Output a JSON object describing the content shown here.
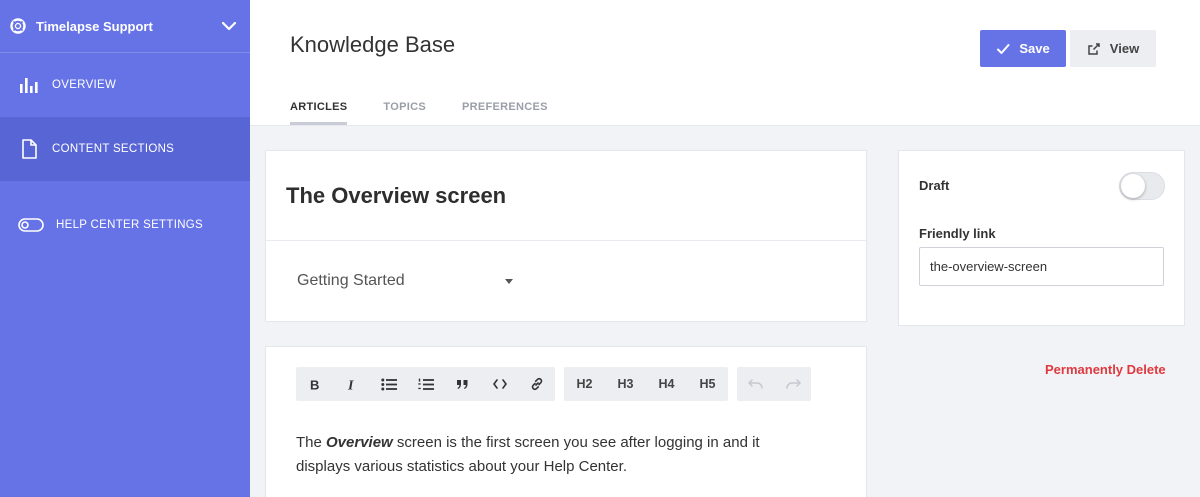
{
  "sidebar": {
    "workspace_name": "Timelapse Support",
    "items": [
      {
        "label": "OVERVIEW",
        "icon": "bar-chart-icon"
      },
      {
        "label": "CONTENT SECTIONS",
        "icon": "document-icon",
        "active": true
      },
      {
        "label": "HELP CENTER SETTINGS",
        "icon": "toggle-icon"
      }
    ]
  },
  "header": {
    "title": "Knowledge Base",
    "save_label": "Save",
    "view_label": "View",
    "tabs": [
      {
        "label": "ARTICLES",
        "active": true
      },
      {
        "label": "TOPICS"
      },
      {
        "label": "PREFERENCES"
      }
    ]
  },
  "article": {
    "title": "The Overview screen",
    "category": "Getting Started",
    "body_pre": "The ",
    "body_emph": "Overview",
    "body_post": " screen is the first screen you see after logging in and it displays various statistics about your Help Center."
  },
  "toolbar": {
    "headings": [
      "H2",
      "H3",
      "H4",
      "H5"
    ]
  },
  "side_panel": {
    "draft_label": "Draft",
    "draft_enabled": false,
    "link_label": "Friendly link",
    "link_value": "the-overview-screen"
  },
  "delete_label": "Permanently Delete",
  "colors": {
    "sidebar": "#6673e6",
    "sidebar_active": "#5865d4",
    "primary": "#6673e6",
    "danger": "#e0393e"
  }
}
